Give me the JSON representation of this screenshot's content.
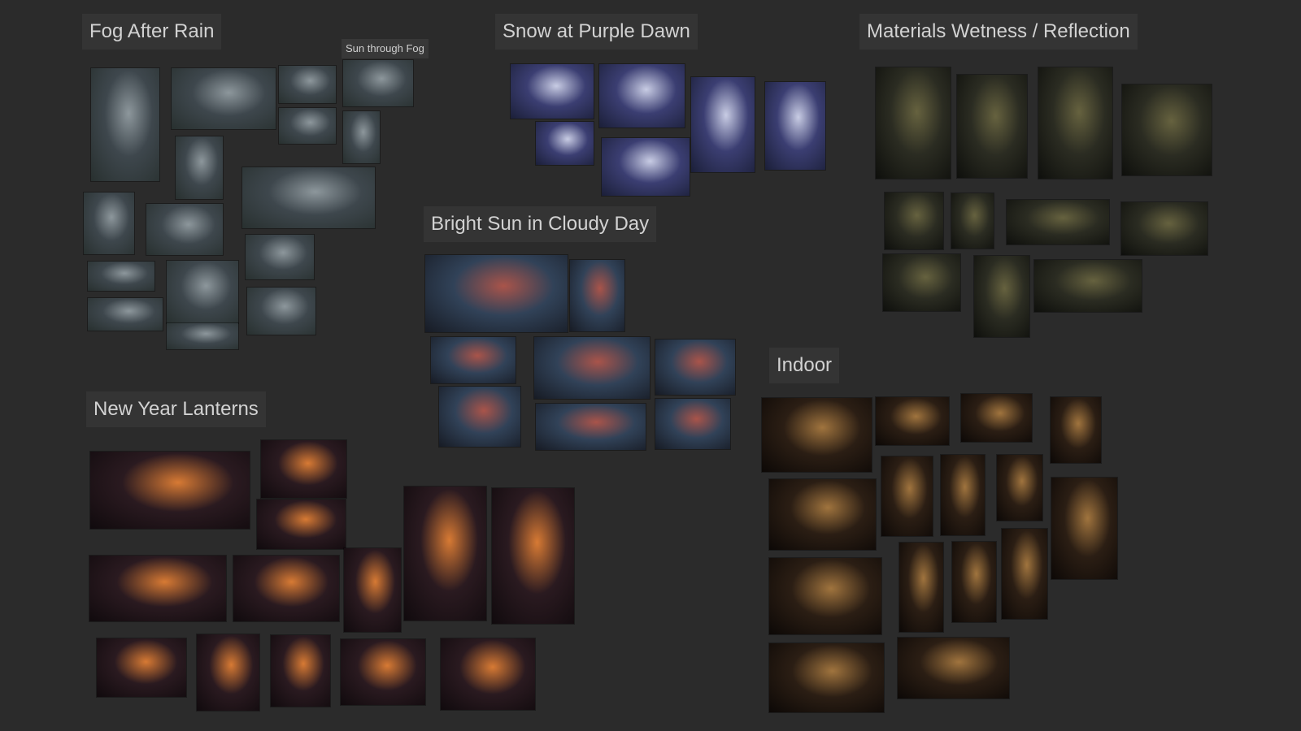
{
  "board": {
    "background": "#2b2b2b",
    "groups": {
      "fog": {
        "title": "Fog After Rain",
        "sub_label": "Sun through Fog"
      },
      "snow": {
        "title": "Snow at Purple Dawn"
      },
      "sun": {
        "title": "Bright Sun in Cloudy Day"
      },
      "materials": {
        "title": "Materials Wetness / Reflection"
      },
      "lanterns": {
        "title": "New Year Lanterns"
      },
      "indoor": {
        "title": "Indoor"
      }
    }
  }
}
